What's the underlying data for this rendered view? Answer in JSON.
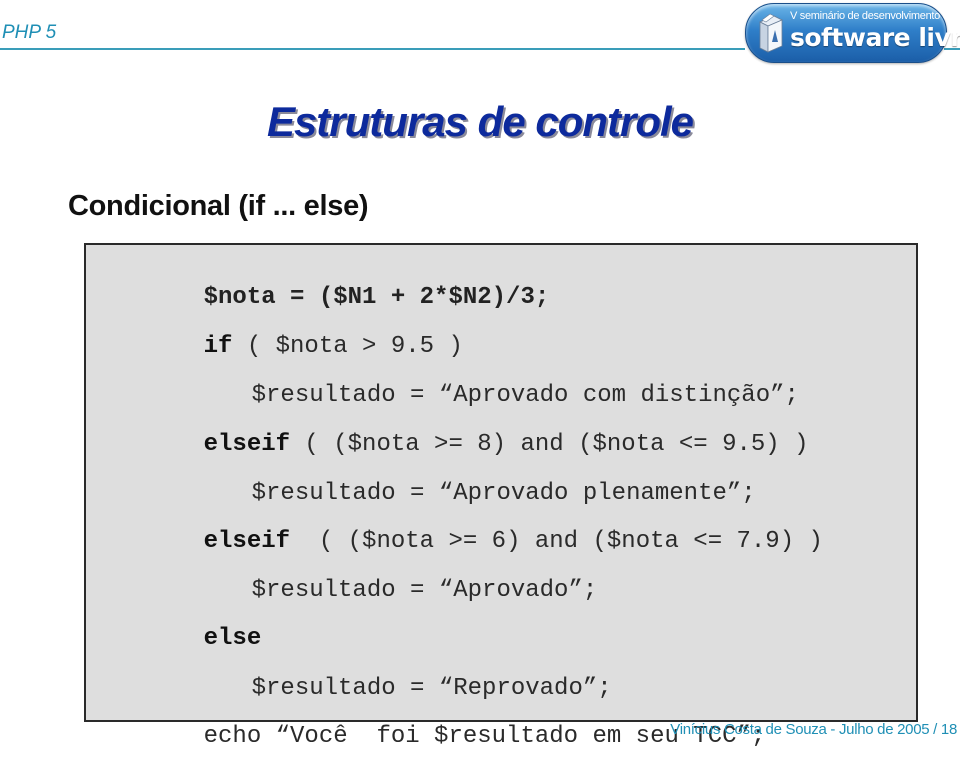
{
  "header": {
    "label": "PHP 5",
    "accent_color": "#1f8fb5",
    "logo": {
      "top_text": "V seminário de desenvolvimento em",
      "main_text": "software livre",
      "icon": "software-box-icon"
    }
  },
  "slide": {
    "title": "Estruturas de controle",
    "title_color": "#0d2a9c",
    "section_heading": "Condicional (if ... else)"
  },
  "code": {
    "lines": [
      {
        "keyword": "",
        "text": "$nota = ($N1 + 2*$N2)/3;"
      },
      {
        "keyword": "if",
        "text": " ( $nota > 9.5 )"
      },
      {
        "keyword": "",
        "text": "$resultado = “Aprovado com distinção”;"
      },
      {
        "keyword": "elseif",
        "text": " ( ($nota >= 8) and ($nota <= 9.5) )"
      },
      {
        "keyword": "",
        "text": "$resultado = “Aprovado plenamente”;"
      },
      {
        "keyword": "elseif",
        "text": "  ( ($nota >= 6) and ($nota <= 7.9) )"
      },
      {
        "keyword": "",
        "text": "$resultado = “Aprovado”;"
      },
      {
        "keyword": "else",
        "text": ""
      },
      {
        "keyword": "",
        "text": "$resultado = “Reprovado”;"
      },
      {
        "keyword": "",
        "text": "echo “Você  foi $resultado em seu TCC”;"
      }
    ]
  },
  "footer": {
    "text": "Vinícius Costa de Souza - Julho de 2005 / 18"
  }
}
